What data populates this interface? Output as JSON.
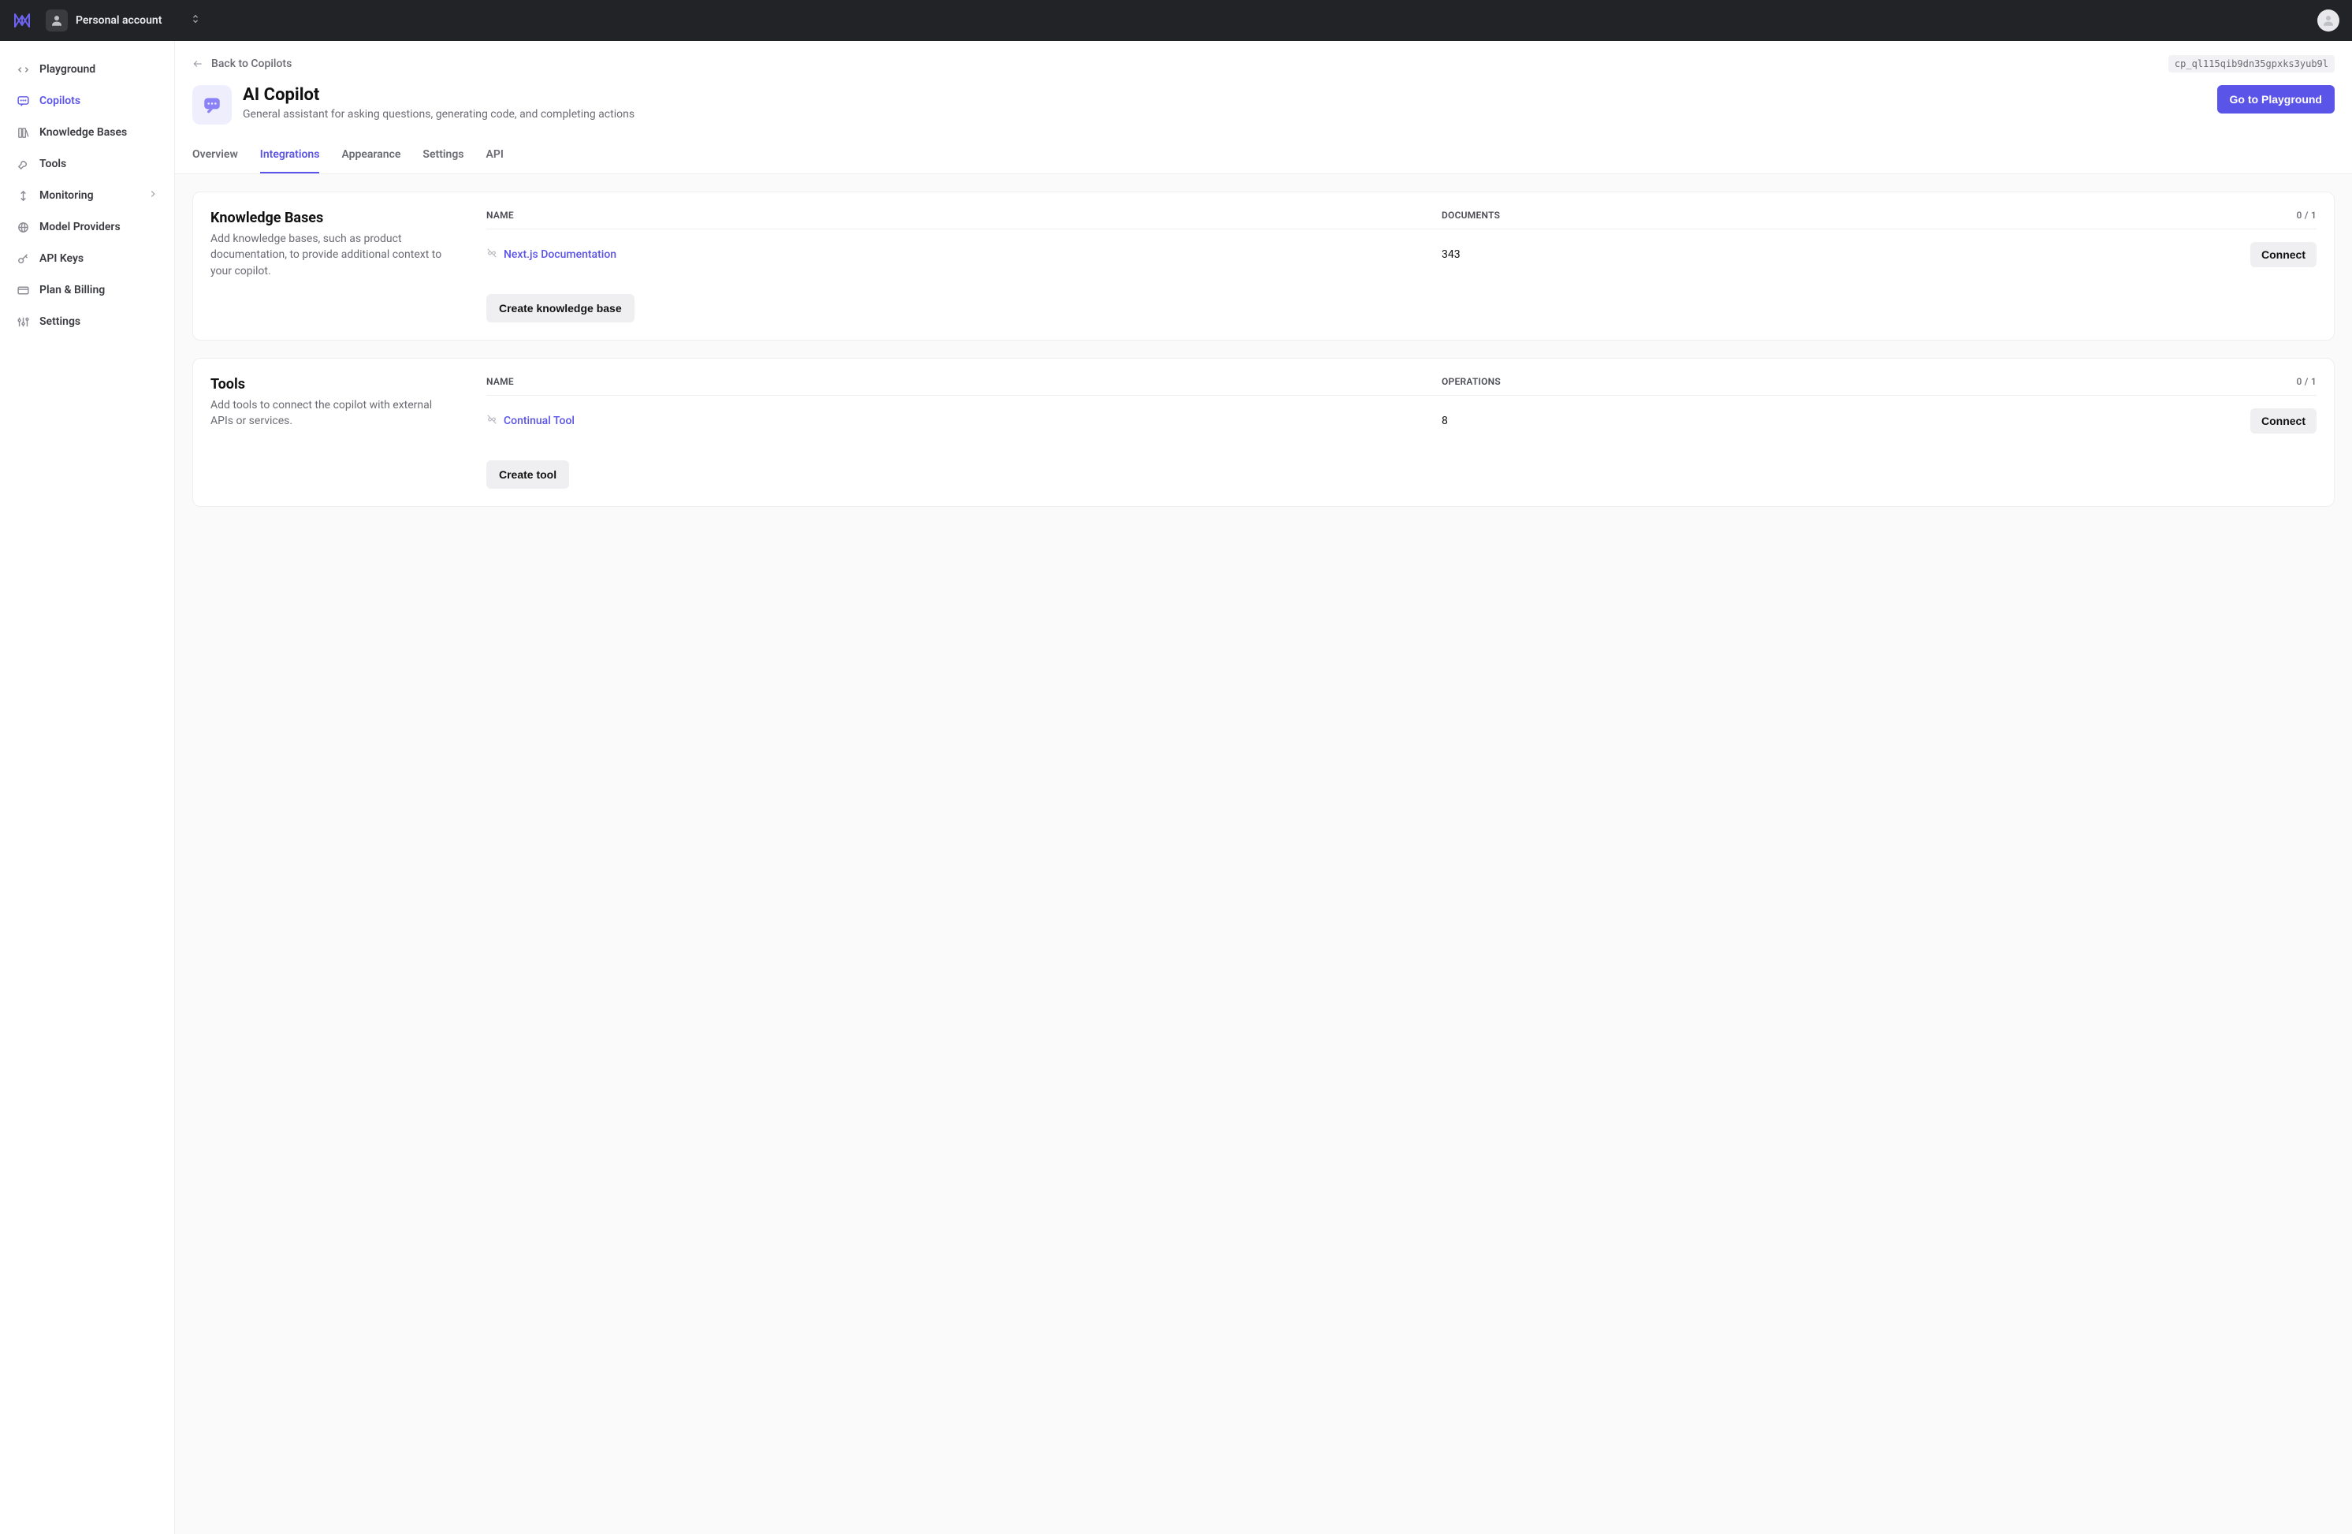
{
  "header": {
    "account_label": "Personal account"
  },
  "sidebar": {
    "items": [
      {
        "label": "Playground",
        "icon": "code-icon"
      },
      {
        "label": "Copilots",
        "icon": "chat-icon",
        "active": true
      },
      {
        "label": "Knowledge Bases",
        "icon": "books-icon"
      },
      {
        "label": "Tools",
        "icon": "wrench-icon"
      },
      {
        "label": "Monitoring",
        "icon": "arrows-icon",
        "expandable": true
      },
      {
        "label": "Model Providers",
        "icon": "globe-icon"
      },
      {
        "label": "API Keys",
        "icon": "key-icon"
      },
      {
        "label": "Plan & Billing",
        "icon": "card-icon"
      },
      {
        "label": "Settings",
        "icon": "sliders-icon"
      }
    ]
  },
  "page": {
    "back_label": "Back to Copilots",
    "copilot_id": "cp_ql115qib9dn35gpxks3yub9l",
    "title": "AI Copilot",
    "subtitle": "General assistant for asking questions, generating code, and completing actions",
    "primary_action": "Go to Playground",
    "tabs": [
      {
        "label": "Overview"
      },
      {
        "label": "Integrations",
        "active": true
      },
      {
        "label": "Appearance"
      },
      {
        "label": "Settings"
      },
      {
        "label": "API"
      }
    ]
  },
  "kb_section": {
    "title": "Knowledge Bases",
    "description": "Add knowledge bases, such as product documentation, to provide additional context to your copilot.",
    "col_name": "NAME",
    "col_mid": "DOCUMENTS",
    "count": "0 / 1",
    "rows": [
      {
        "name": "Next.js Documentation",
        "value": "343",
        "action": "Connect"
      }
    ],
    "create_label": "Create knowledge base"
  },
  "tools_section": {
    "title": "Tools",
    "description": "Add tools to connect the copilot with external APIs or services.",
    "col_name": "NAME",
    "col_mid": "OPERATIONS",
    "count": "0 / 1",
    "rows": [
      {
        "name": "Continual Tool",
        "value": "8",
        "action": "Connect"
      }
    ],
    "create_label": "Create tool"
  }
}
